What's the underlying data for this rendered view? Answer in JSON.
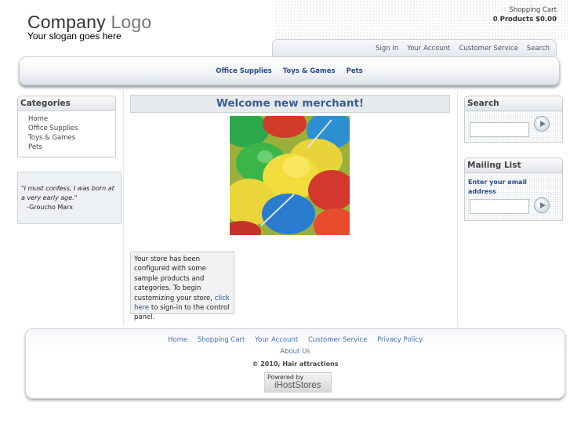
{
  "header": {
    "logo_word1": "Company",
    "logo_word2": "Logo",
    "slogan": "Your slogan goes here",
    "cart_label": "Shopping Cart",
    "cart_summary": "0 Products $0.00"
  },
  "top_nav": [
    "Sign In",
    "Your Account",
    "Customer Service",
    "Search"
  ],
  "category_bar": [
    "Office Supplies",
    "Toys & Games",
    "Pets"
  ],
  "categories_box": {
    "title": "Categories",
    "items": [
      "Home",
      "Office Supplies",
      "Toys & Games",
      "Pets"
    ]
  },
  "quote": {
    "text": "\"I must confess, I was born at a very early age.\"",
    "author": "-Groucho Marx"
  },
  "main": {
    "welcome": "Welcome new merchant!",
    "info_before": "Your store has been configured with some sample products and categories. To begin customizing your store,",
    "info_link": "click here",
    "info_after": "to sign-in to the control panel."
  },
  "search_box": {
    "title": "Search",
    "input_value": ""
  },
  "mailing_box": {
    "title": "Mailing List",
    "prompt": "Enter your email address",
    "input_value": ""
  },
  "footer": {
    "links_row1": [
      "Home",
      "Shopping Cart",
      "Your Account",
      "Customer Service",
      "Privacy Policy"
    ],
    "links_row2": [
      "About Us"
    ],
    "copyright": "© 2010, Hair attractions",
    "powered_by": "Powered by",
    "powered_brand": "iHostStores"
  },
  "colors": {
    "link_blue": "#4a6fb0",
    "title_blue": "#3a5f96",
    "nav_bold_blue": "#2a4a8a"
  }
}
